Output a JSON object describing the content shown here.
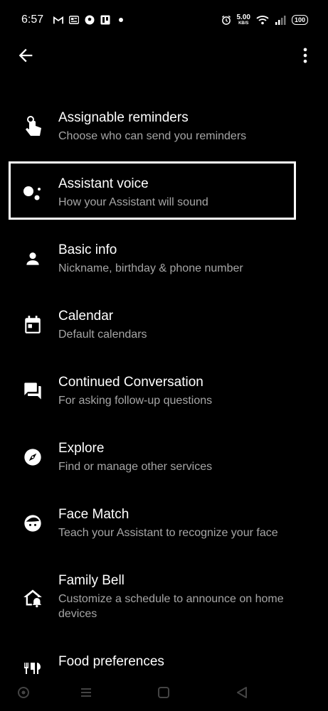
{
  "status_bar": {
    "time": "6:57",
    "speed_value": "5.00",
    "speed_unit": "KB/S",
    "battery": "100"
  },
  "app_bar": {
    "back_icon": "arrow-back-icon",
    "more_icon": "more-vert-icon"
  },
  "items": [
    {
      "title": "Assignable reminders",
      "subtitle": "Choose who can send you reminders",
      "icon": "touch-hand-icon"
    },
    {
      "title": "Assistant voice",
      "subtitle": "How your Assistant will sound",
      "icon": "assistant-dots-icon"
    },
    {
      "title": "Basic info",
      "subtitle": "Nickname, birthday & phone number",
      "icon": "person-icon"
    },
    {
      "title": "Calendar",
      "subtitle": "Default calendars",
      "icon": "calendar-icon"
    },
    {
      "title": "Continued Conversation",
      "subtitle": "For asking follow-up questions",
      "icon": "forum-icon"
    },
    {
      "title": "Explore",
      "subtitle": "Find or manage other services",
      "icon": "compass-icon"
    },
    {
      "title": "Face Match",
      "subtitle": "Teach your Assistant to recognize your face",
      "icon": "face-icon"
    },
    {
      "title": "Family Bell",
      "subtitle": "Customize a schedule to announce on home devices",
      "icon": "home-bell-icon"
    },
    {
      "title": "Food preferences",
      "subtitle": "",
      "icon": "food-icon"
    }
  ],
  "colors": {
    "background": "#000000",
    "title": "#ffffff",
    "subtitle": "#a6a6a6",
    "highlight_border": "#ffffff"
  }
}
